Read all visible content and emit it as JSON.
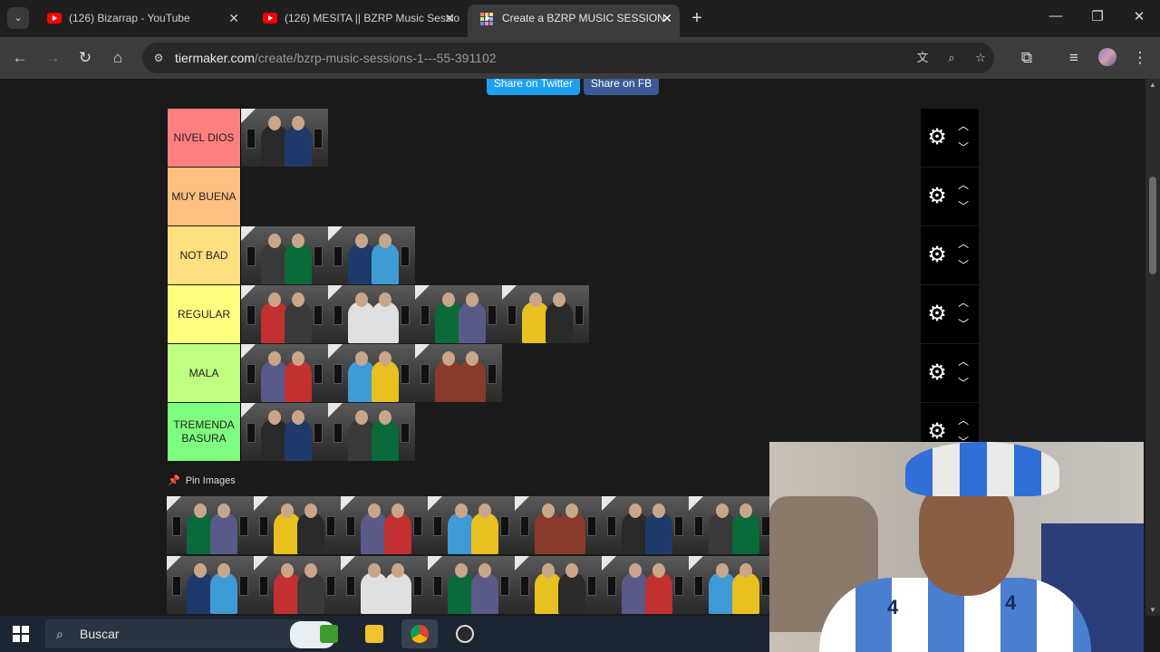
{
  "browser": {
    "tabs": [
      {
        "title": "(126) Bizarrap - YouTube",
        "active": false
      },
      {
        "title": "(126) MESITA || BZRP Music Sessio",
        "active": false
      },
      {
        "title": "Create a BZRP MUSIC SESSION",
        "active": true
      }
    ],
    "new_tab": "+",
    "url_host": "tiermaker.com",
    "url_path": "/create/bzrp-music-sessions-1---55-391102"
  },
  "page": {
    "share_twitter": "Share on Twitter",
    "share_fb": "Share on FB",
    "tiers": [
      {
        "label": "NIVEL DIOS",
        "color": "#ff7f7f",
        "items": 1
      },
      {
        "label": "MUY BUENA",
        "color": "#ffbf7f",
        "items": 0
      },
      {
        "label": "NOT BAD",
        "color": "#ffdf7f",
        "items": 2
      },
      {
        "label": "REGULAR",
        "color": "#ffff7f",
        "items": 4
      },
      {
        "label": "MALA",
        "color": "#bfff7f",
        "items": 3
      },
      {
        "label": "TREMENDA BASURA",
        "color": "#7fff7f",
        "items": 2
      }
    ],
    "pin_label": "Pin Images",
    "pool_count": 14
  },
  "taskbar": {
    "search_placeholder": "Buscar"
  },
  "icons": {
    "tab_search": "chevron-down-icon",
    "settings": "gear-icon",
    "move_up": "chevron-up-icon",
    "move_down": "chevron-down-icon",
    "pin": "pin-icon"
  }
}
